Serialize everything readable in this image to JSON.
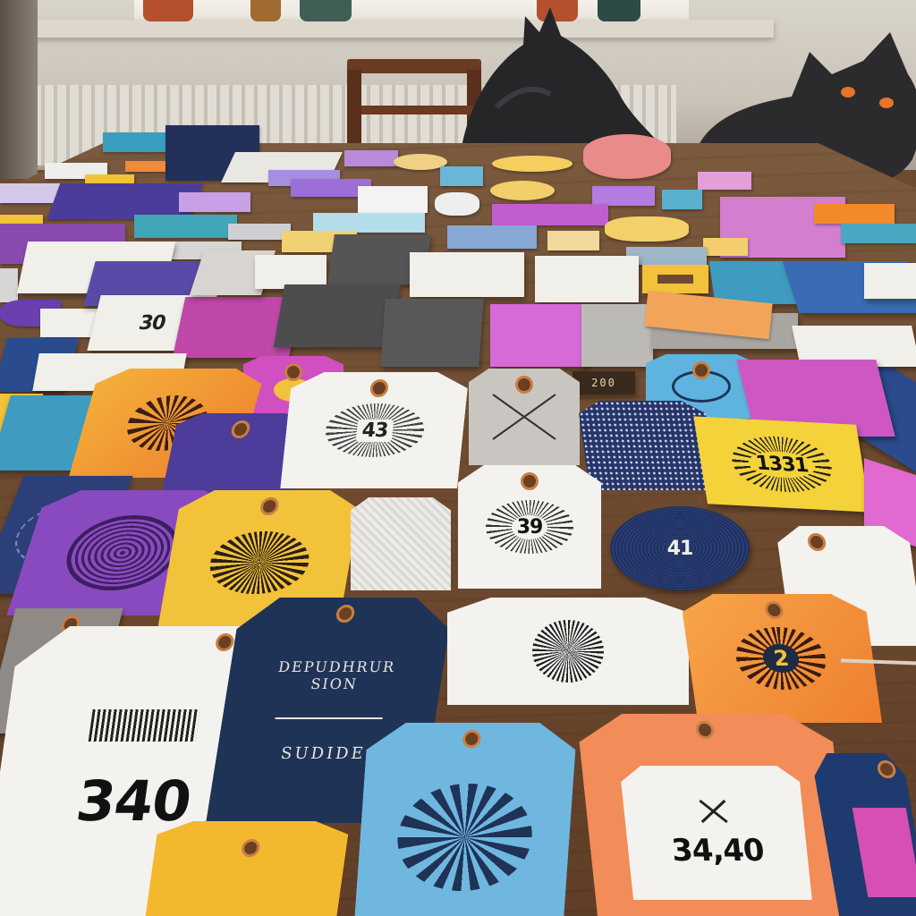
{
  "tags": {
    "t1": "30",
    "t2": "43",
    "t3": "39",
    "t4": "41",
    "t5": "1331",
    "t6": "2",
    "t7": "340",
    "t8": "34,40",
    "t9": "SUDIDE",
    "t10": "DEPUDHRUR SION",
    "t11": "200"
  },
  "colors": {
    "table_wood": "#6e4b30",
    "navy": "#1f3357",
    "purple": "#6a3fb0",
    "magenta": "#c048a8",
    "yellow": "#f2c23a",
    "orange": "#ef8a3a",
    "teal": "#3f9bbf",
    "cream": "#f1efe9",
    "grey": "#8f8a85"
  },
  "icons": [
    "cat-silhouette-left",
    "cat-silhouette-right",
    "chair",
    "tag-hole"
  ]
}
